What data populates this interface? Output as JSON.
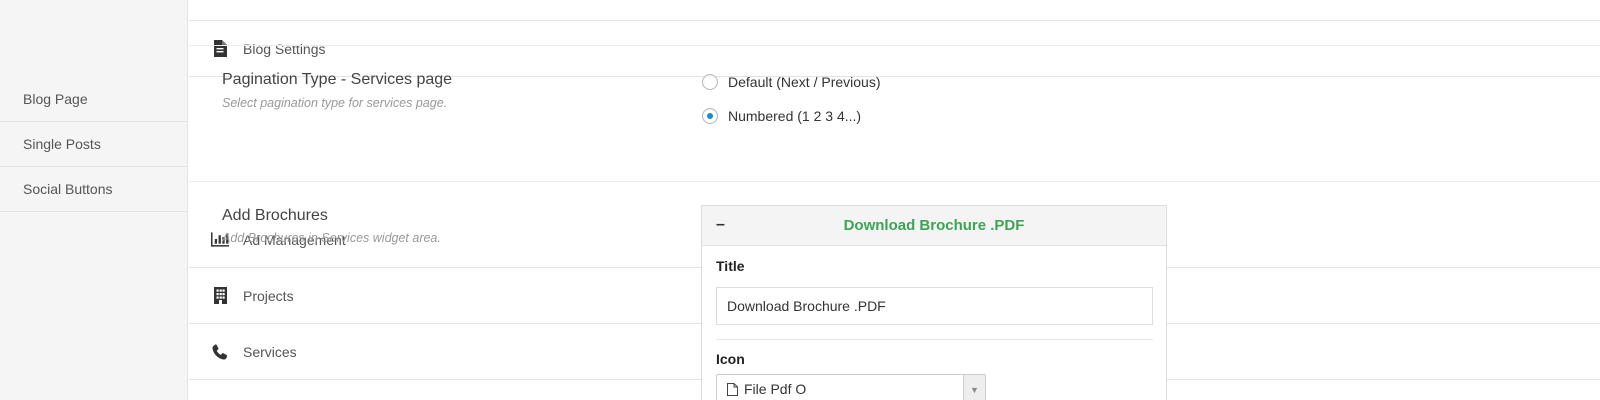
{
  "sidebar": {
    "items": [
      {
        "label": "",
        "icon": "none"
      },
      {
        "label": "Blog Settings",
        "icon": "document-icon"
      },
      {
        "label": "Blog Page"
      },
      {
        "label": "Single Posts"
      },
      {
        "label": "Social Buttons"
      },
      {
        "label": "Ad Management",
        "icon": "bar-chart-icon"
      },
      {
        "label": "Projects",
        "icon": "building-icon"
      },
      {
        "label": "Services",
        "icon": "phone-icon"
      }
    ],
    "active": "Services"
  },
  "pagination": {
    "title": "Pagination Type - Services page",
    "description": "Select pagination type for services page.",
    "options": [
      {
        "label": "Default (Next / Previous)",
        "checked": false
      },
      {
        "label": "Numbered (1 2 3 4...)",
        "checked": true
      }
    ]
  },
  "brochures": {
    "title": "Add Brochures",
    "description": "Add Brochures in Services widget area.",
    "widget": {
      "toggle": "–",
      "header": "Download Brochure .PDF",
      "title_label": "Title",
      "title_value": "Download Brochure .PDF",
      "icon_label": "Icon",
      "icon_value": "File Pdf O"
    }
  },
  "colors": {
    "accent": "#3aa655",
    "radio": "#1e8cbe"
  }
}
